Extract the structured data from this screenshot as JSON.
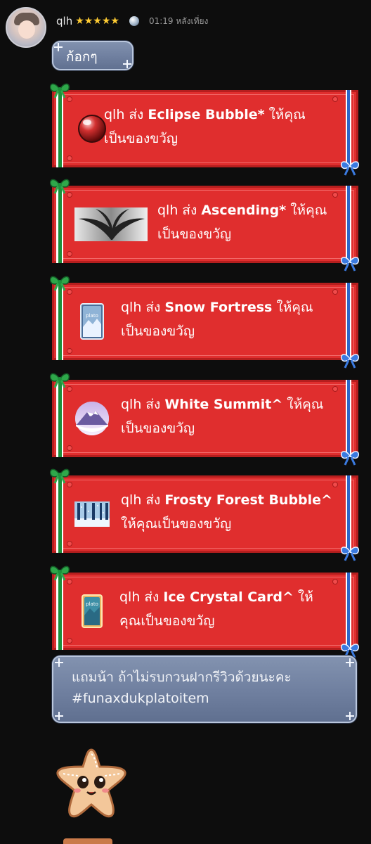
{
  "message_header": {
    "username": "qlh",
    "stars": "★★★★★",
    "time": "01:19 หลังเที่ยง"
  },
  "messages": {
    "first_text": "ก้อกๆ",
    "last_text_line1": "แถมน้า ถ้าไม่รบกวนฝากรีวิวด้วยนะคะ",
    "last_text_line2": "#funaxdukplatoitem"
  },
  "gifts": [
    {
      "line1_prefix": "qlh ส่ง ",
      "item": "Eclipse Bubble*",
      "line1_suffix": " ให้คุณ",
      "line2": "เป็นของขวัญ",
      "icon": "eclipse-bubble-icon"
    },
    {
      "line1_prefix": "qlh ส่ง ",
      "item": "Ascending*",
      "line1_suffix": " ให้คุณ",
      "line2": "เป็นของขวัญ",
      "icon": "ascending-wings-image"
    },
    {
      "line1_prefix": "qlh ส่ง ",
      "item": "Snow Fortress",
      "line1_suffix": " ให้คุณ",
      "line2": "เป็นของขวัญ",
      "icon": "snow-fortress-card-icon"
    },
    {
      "line1_prefix": "qlh ส่ง ",
      "item": "White Summit^",
      "line1_suffix": " ให้คุณ",
      "line2": "เป็นของขวัญ",
      "icon": "white-summit-mountain-icon"
    },
    {
      "line1_prefix": "qlh ส่ง ",
      "item": "Frosty Forest Bubble^",
      "line1_suffix": "",
      "line2": "ให้คุณเป็นของขวัญ",
      "icon": "frosty-forest-image"
    },
    {
      "line1_prefix": "qlh ส่ง ",
      "item": "Ice Crystal Card^",
      "line1_suffix": " ให้",
      "line2": "คุณเป็นของขวัญ",
      "icon": "ice-crystal-card-icon"
    }
  ],
  "card_brand": "plato",
  "colors": {
    "background": "#0d0d0d",
    "gift_red": "#e02e2e",
    "ribbon_green": "#1d8f3a",
    "ribbon_blue": "#2d67c9",
    "ice_bubble": "#7383a3",
    "star_gold": "#ffcc33"
  }
}
